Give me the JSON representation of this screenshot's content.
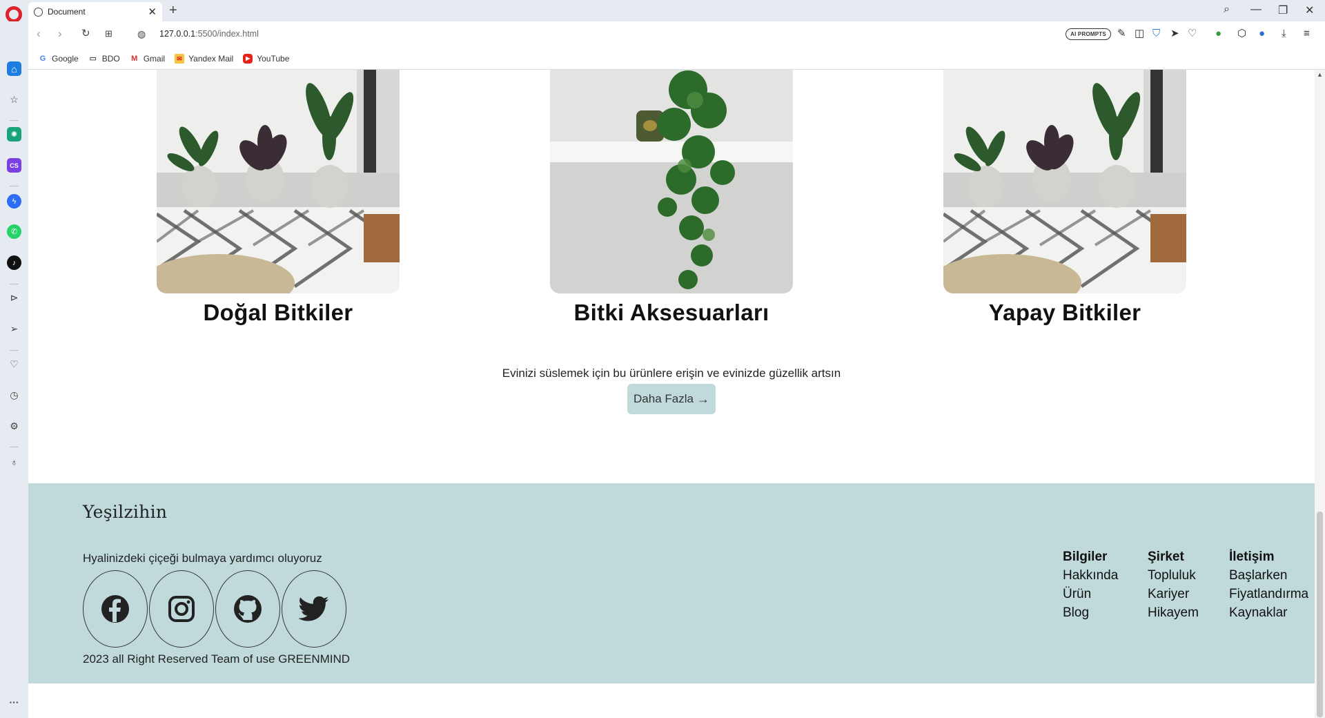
{
  "browser": {
    "tab_title": "Document",
    "url_host": "127.0.0.1",
    "url_path": ":5500/index.html",
    "ai_badge": "AI PROMPTS",
    "bookmarks": [
      {
        "label": "Google",
        "icon": "google-icon"
      },
      {
        "label": "BDO",
        "icon": "folder-icon"
      },
      {
        "label": "Gmail",
        "icon": "gmail-icon"
      },
      {
        "label": "Yandex Mail",
        "icon": "yandex-mail-icon"
      },
      {
        "label": "YouTube",
        "icon": "youtube-icon"
      }
    ]
  },
  "cards": [
    {
      "title": "Doğal Bitkiler",
      "image": "potted-plants-photo"
    },
    {
      "title": "Bitki Aksesuarları",
      "image": "hanging-plant-photo"
    },
    {
      "title": "Yapay Bitkiler",
      "image": "potted-plants-photo"
    }
  ],
  "cta": {
    "text": "Evinizi süslemek için bu ürünlere erişin ve evinizde güzellik artsın",
    "button": "Daha Fazla",
    "button_icon": "arrow-right-icon"
  },
  "footer": {
    "logo": "Yeşilzihin",
    "tagline": "Hyalinizdeki çiçeği bulmaya yardımcı oluyoruz",
    "socials": [
      "facebook-icon",
      "instagram-icon",
      "github-icon",
      "twitter-icon"
    ],
    "copyright": "2023 all Right Reserved Team of use GREENMIND",
    "columns": [
      {
        "heading": "Bilgiler",
        "links": [
          "Hakkında",
          "Ürün",
          "Blog"
        ]
      },
      {
        "heading": "Şirket",
        "links": [
          "Topluluk",
          "Kariyer",
          "Hikayem"
        ]
      },
      {
        "heading": "İletişim",
        "links": [
          "Başlarken",
          "Fiyatlandırma",
          "Kaynaklar"
        ]
      }
    ]
  },
  "colors": {
    "footer_bg": "#c0dadb",
    "button_bg": "#c0dadb",
    "chrome_bg": "#e6ebf1",
    "opera_red": "#e0202a"
  }
}
